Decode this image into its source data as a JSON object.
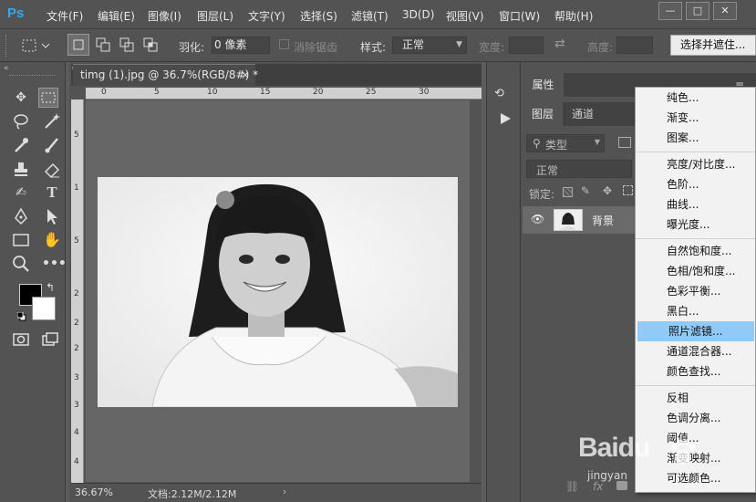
{
  "app": {
    "logo": "Ps"
  },
  "menubar": {
    "items": [
      "文件(F)",
      "编辑(E)",
      "图像(I)",
      "图层(L)",
      "文字(Y)",
      "选择(S)",
      "滤镜(T)",
      "3D(D)",
      "视图(V)",
      "窗口(W)",
      "帮助(H)"
    ]
  },
  "window_controls": {
    "minimize": "—",
    "restore": "□",
    "close": "✕"
  },
  "options": {
    "feather_label": "羽化:",
    "feather_value": "0 像素",
    "antialias_label": "消除锯齿",
    "style_label": "样式:",
    "style_value": "正常",
    "width_label": "宽度:",
    "height_label": "高度:",
    "select_mask_button": "选择并遮住..."
  },
  "document": {
    "tab_title": "timg (1).jpg @ 36.7%(RGB/8#) *",
    "tab_close": "×",
    "zoom": "36.67%",
    "doc_info": "文档:2.12M/2.12M",
    "ruler_top_labels": [
      "0",
      "5",
      "10",
      "15",
      "20",
      "25",
      "30"
    ],
    "ruler_left_labels": [
      "5",
      "1",
      "5",
      "2",
      "2",
      "2",
      "3",
      "3",
      "4",
      "4"
    ]
  },
  "panels": {
    "properties_tab": "属性",
    "layers_tab": "图层",
    "channels_tab": "通道",
    "filter_kind": "类型",
    "blend_mode": "正常",
    "lock_label": "锁定:",
    "layer_name": "背景"
  },
  "context_menu": {
    "groups": [
      [
        "纯色...",
        "渐变...",
        "图案..."
      ],
      [
        "亮度/对比度...",
        "色阶...",
        "曲线...",
        "曝光度..."
      ],
      [
        "自然饱和度...",
        "色相/饱和度...",
        "色彩平衡...",
        "黑白...",
        "照片滤镜...",
        "通道混合器...",
        "颜色查找..."
      ],
      [
        "反相",
        "色调分离...",
        "阈值...",
        "渐变映射...",
        "可选颜色..."
      ]
    ],
    "highlighted": "照片滤镜..."
  },
  "watermark": {
    "brand": "Baidu",
    "sub": "jingyan"
  },
  "colors": {
    "ui_bg": "#535353",
    "highlight": "#91c9f7",
    "ps_blue": "#31a8ff"
  }
}
